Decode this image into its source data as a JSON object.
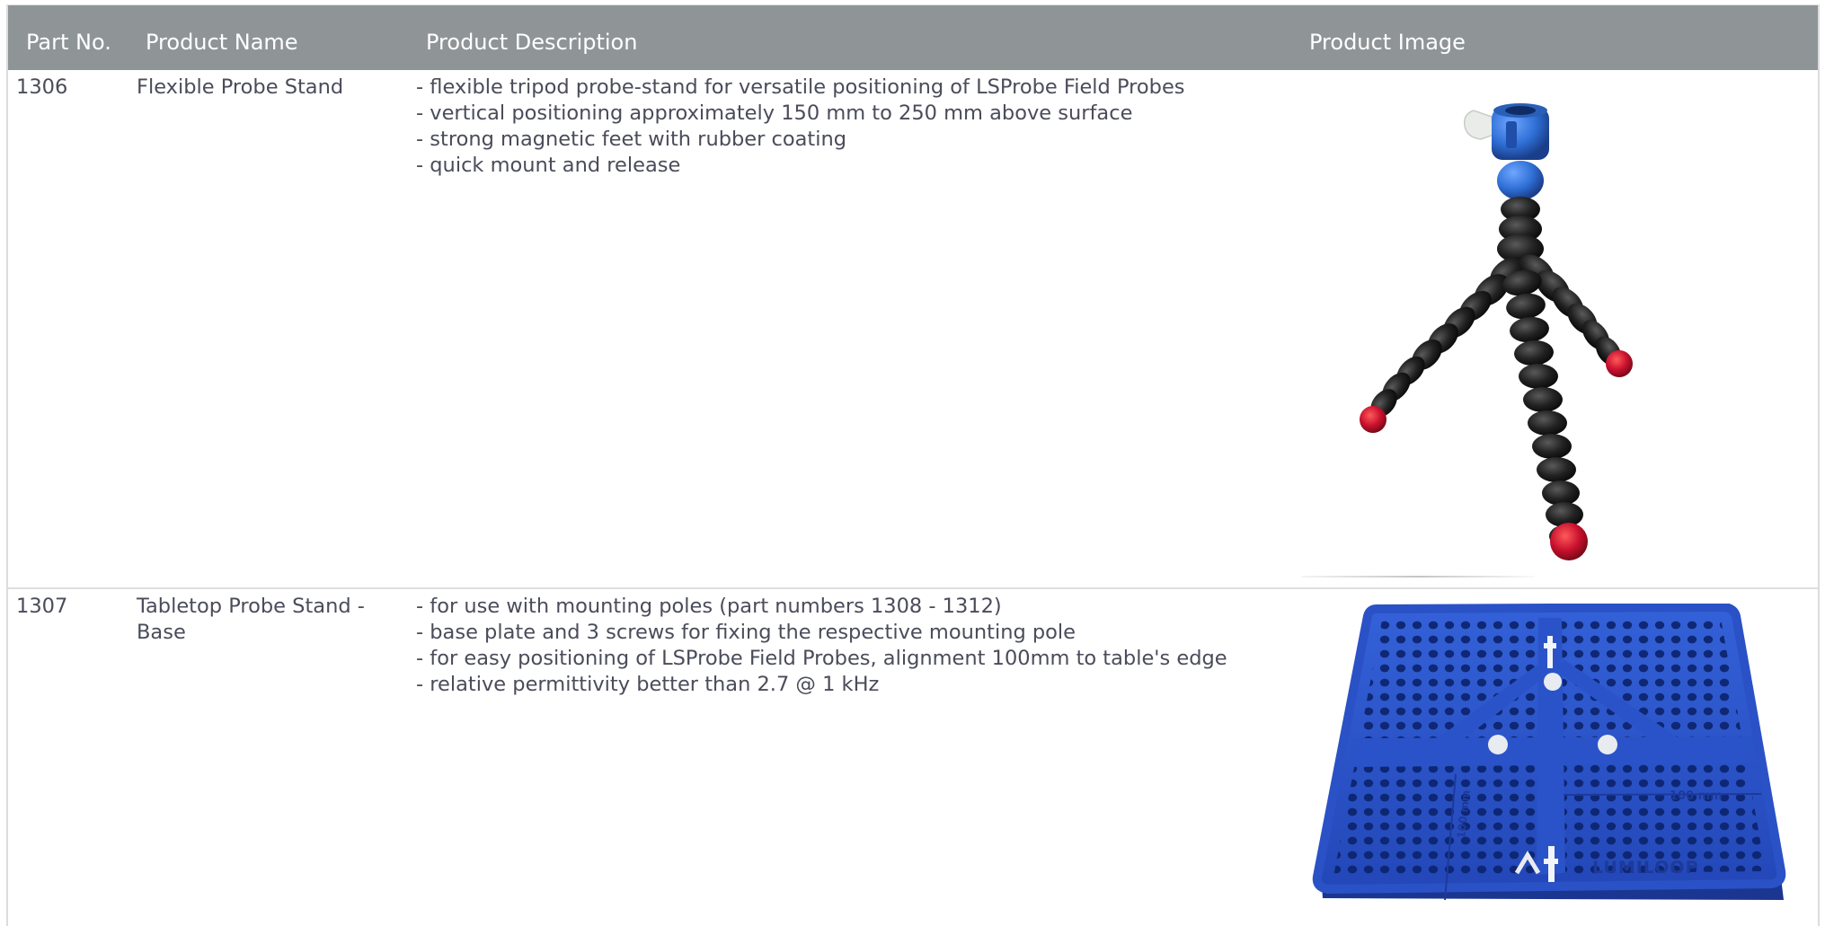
{
  "table": {
    "headers": {
      "part_no": "Part No.",
      "product_name": "Product Name",
      "product_description": "Product Description",
      "product_image": "Product Image"
    },
    "rows": [
      {
        "part_no": "1306",
        "name_lines": [
          "Flexible Probe Stand"
        ],
        "description": [
          "- flexible tripod probe-stand for versatile positioning of LSProbe Field Probes",
          "- vertical positioning approximately 150 mm to 250 mm above surface",
          "- strong magnetic feet with rubber coating",
          "- quick mount and release"
        ],
        "image_icon": "flexible-tripod-image"
      },
      {
        "part_no": "1307",
        "name_lines": [
          "Tabletop Probe Stand -",
          "Base"
        ],
        "description": [
          "- for use with mounting poles (part numbers 1308 - 1312)",
          "- base plate and 3 screws for fixing the respective mounting pole",
          "- for easy positioning of LSProbe Field Probes, alignment 100mm to table's edge",
          "- relative permittivity better than 2.7 @ 1 kHz"
        ],
        "image_icon": "blue-base-plate-image",
        "image_texts": {
          "dim_horizontal": "100 mm",
          "dim_vertical": "100 mm",
          "brand": "LUMILOOP"
        }
      }
    ]
  },
  "colors": {
    "header_bg": "#8f9597",
    "header_text": "#ffffff",
    "body_text": "#4a4c5a",
    "divider": "#dedede",
    "plate_blue": "#2b53c9",
    "tripod_blue": "#2f6fd6",
    "foot_red": "#c8102e"
  }
}
